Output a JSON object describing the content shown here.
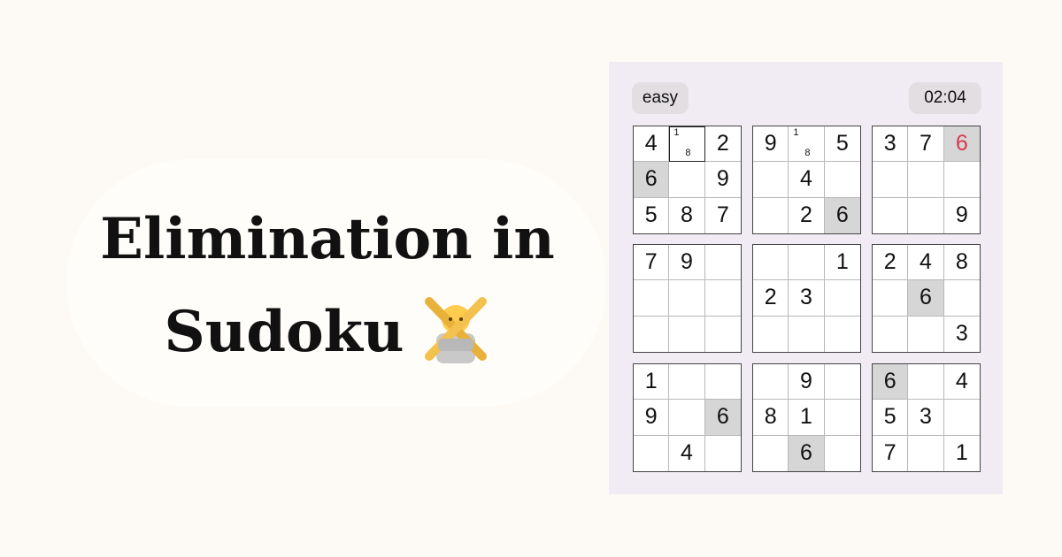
{
  "title": {
    "line1": "Elimination in",
    "line2": "Sudoku",
    "emoji_icon": "person-gesturing-no-icon"
  },
  "game": {
    "difficulty": "easy",
    "timer": "02:04",
    "error_color": "#d8394f",
    "highlight_color": "#d6d6d6",
    "boxes": [
      {
        "cells": [
          {
            "v": "4"
          },
          {
            "v": "",
            "notes": [
              "1",
              "8"
            ],
            "selected": true
          },
          {
            "v": "2"
          },
          {
            "v": "6",
            "hl": true
          },
          {
            "v": ""
          },
          {
            "v": "9"
          },
          {
            "v": "5"
          },
          {
            "v": "8"
          },
          {
            "v": "7"
          }
        ]
      },
      {
        "cells": [
          {
            "v": "9"
          },
          {
            "v": "",
            "notes": [
              "1",
              "8"
            ]
          },
          {
            "v": "5"
          },
          {
            "v": ""
          },
          {
            "v": "4"
          },
          {
            "v": ""
          },
          {
            "v": ""
          },
          {
            "v": "2"
          },
          {
            "v": "6",
            "hl": true
          }
        ]
      },
      {
        "cells": [
          {
            "v": "3"
          },
          {
            "v": "7"
          },
          {
            "v": "6",
            "hl": true,
            "err": true
          },
          {
            "v": ""
          },
          {
            "v": ""
          },
          {
            "v": ""
          },
          {
            "v": ""
          },
          {
            "v": ""
          },
          {
            "v": "9"
          }
        ]
      },
      {
        "cells": [
          {
            "v": "7"
          },
          {
            "v": "9"
          },
          {
            "v": ""
          },
          {
            "v": ""
          },
          {
            "v": ""
          },
          {
            "v": ""
          },
          {
            "v": ""
          },
          {
            "v": ""
          },
          {
            "v": ""
          }
        ]
      },
      {
        "cells": [
          {
            "v": ""
          },
          {
            "v": ""
          },
          {
            "v": "1"
          },
          {
            "v": "2"
          },
          {
            "v": "3"
          },
          {
            "v": ""
          },
          {
            "v": ""
          },
          {
            "v": ""
          },
          {
            "v": ""
          }
        ]
      },
      {
        "cells": [
          {
            "v": "2"
          },
          {
            "v": "4"
          },
          {
            "v": "8"
          },
          {
            "v": ""
          },
          {
            "v": "6",
            "hl": true
          },
          {
            "v": ""
          },
          {
            "v": ""
          },
          {
            "v": ""
          },
          {
            "v": "3"
          }
        ]
      },
      {
        "cells": [
          {
            "v": "1"
          },
          {
            "v": ""
          },
          {
            "v": ""
          },
          {
            "v": "9"
          },
          {
            "v": ""
          },
          {
            "v": "6",
            "hl": true
          },
          {
            "v": ""
          },
          {
            "v": "4"
          },
          {
            "v": ""
          }
        ]
      },
      {
        "cells": [
          {
            "v": ""
          },
          {
            "v": "9"
          },
          {
            "v": ""
          },
          {
            "v": "8"
          },
          {
            "v": "1"
          },
          {
            "v": ""
          },
          {
            "v": ""
          },
          {
            "v": "6",
            "hl": true
          },
          {
            "v": ""
          }
        ]
      },
      {
        "cells": [
          {
            "v": "6",
            "hl": true
          },
          {
            "v": ""
          },
          {
            "v": "4"
          },
          {
            "v": "5"
          },
          {
            "v": "3"
          },
          {
            "v": ""
          },
          {
            "v": "7"
          },
          {
            "v": ""
          },
          {
            "v": "1"
          }
        ]
      }
    ]
  }
}
